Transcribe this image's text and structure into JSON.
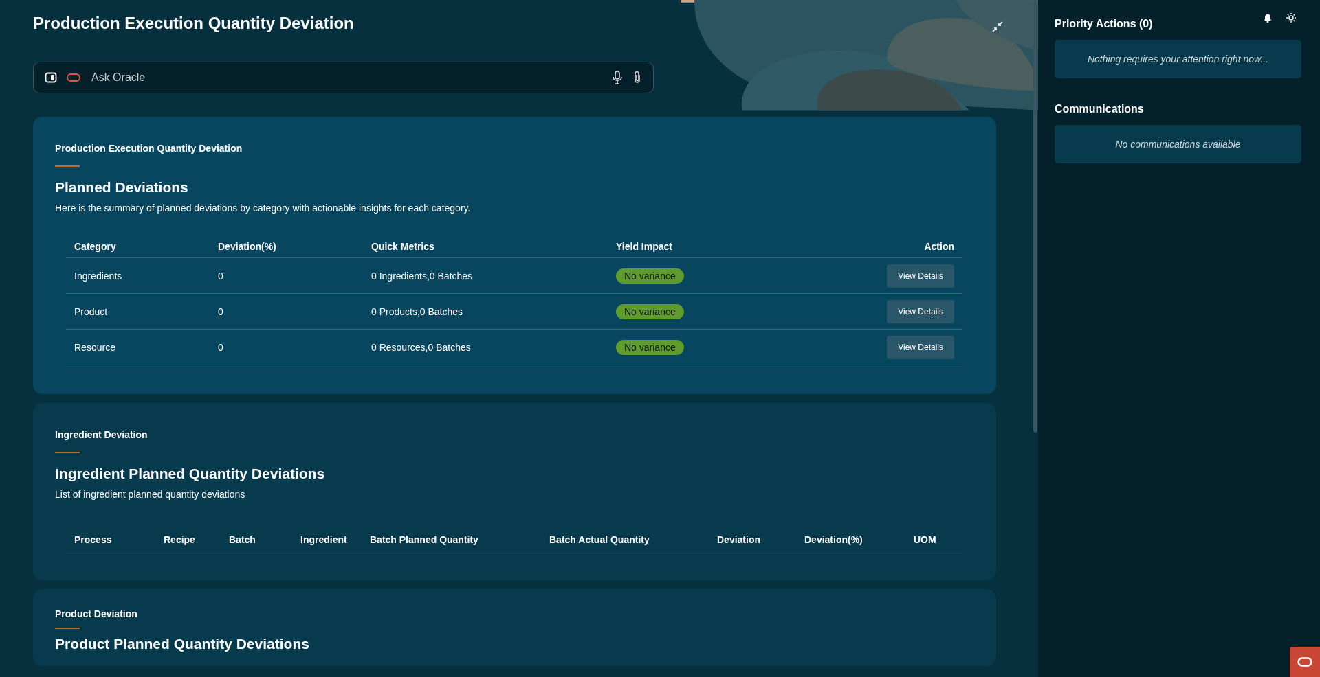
{
  "page": {
    "title": "Production Execution Quantity Deviation"
  },
  "search": {
    "placeholder": "Ask Oracle"
  },
  "cards": [
    {
      "kind": "summary",
      "eyebrow": "Production Execution Quantity Deviation",
      "heading": "Planned Deviations",
      "description": "Here is the summary of planned deviations by category with actionable insights for each category.",
      "columns": [
        "Category",
        "Deviation(%)",
        "Quick Metrics",
        "Yield Impact",
        "Action"
      ],
      "rows": [
        {
          "category": "Ingredients",
          "deviation": "0",
          "metrics": "0 Ingredients,0 Batches",
          "impact": "No variance",
          "action": "View Details"
        },
        {
          "category": "Product",
          "deviation": "0",
          "metrics": "0 Products,0 Batches",
          "impact": "No variance",
          "action": "View Details"
        },
        {
          "category": "Resource",
          "deviation": "0",
          "metrics": "0 Resources,0 Batches",
          "impact": "No variance",
          "action": "View Details"
        }
      ]
    },
    {
      "kind": "list",
      "eyebrow": "Ingredient Deviation",
      "heading": "Ingredient Planned Quantity Deviations",
      "description": "List of ingredient planned quantity deviations",
      "columns": [
        "Process",
        "Recipe",
        "Batch",
        "Ingredient",
        "Batch Planned Quantity",
        "Batch Actual Quantity",
        "Deviation",
        "Deviation(%)",
        "UOM"
      ]
    },
    {
      "kind": "list",
      "eyebrow": "Product Deviation",
      "heading": "Product Planned Quantity Deviations"
    }
  ],
  "sidebar": {
    "sections": [
      {
        "title": "Priority Actions (0)",
        "message": "Nothing requires your attention right now..."
      },
      {
        "title": "Communications",
        "message": "No communications available"
      }
    ]
  }
}
